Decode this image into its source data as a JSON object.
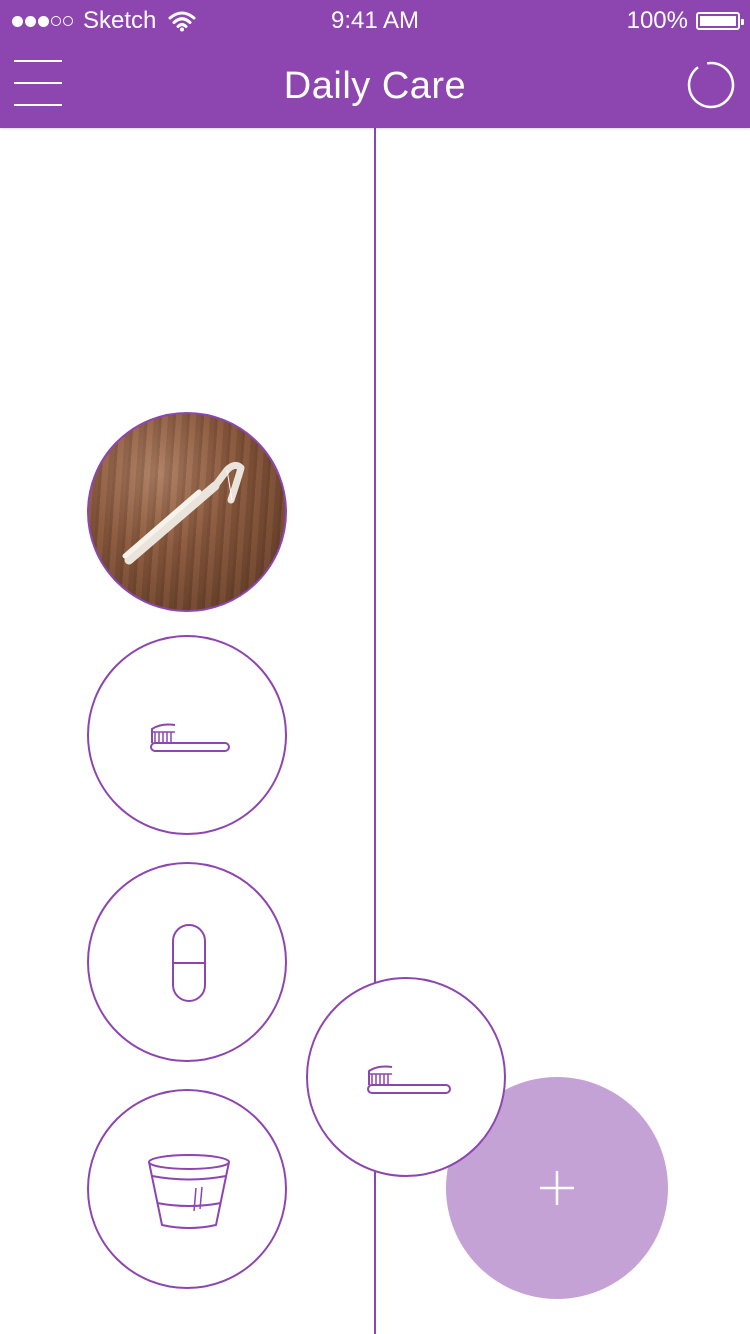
{
  "status_bar": {
    "signal_bars": [
      "full",
      "full",
      "full",
      "empty",
      "empty"
    ],
    "carrier": "Sketch",
    "time": "9:41 AM",
    "battery_percent": "100%",
    "battery_level": 1.0,
    "wifi_icon": "wifi-icon"
  },
  "header": {
    "title": "Daily Care",
    "menu_icon": "hamburger-menu-icon",
    "progress_icon": "progress-ring-icon",
    "background_color": "#8d45b0"
  },
  "tasks": [
    {
      "icon": "floss-pick-photo",
      "completed": true
    },
    {
      "icon": "toothbrush-icon",
      "completed": false
    },
    {
      "icon": "pill-capsule-icon",
      "completed": false
    },
    {
      "icon": "rinse-cup-icon",
      "completed": false
    }
  ],
  "dragging_task": {
    "icon": "toothbrush-icon"
  },
  "add_button": {
    "icon": "plus-icon",
    "color": "#c5a2d5"
  },
  "colors": {
    "accent": "#8d45b0",
    "light_accent": "#c5a2d5",
    "background": "#ffffff"
  }
}
